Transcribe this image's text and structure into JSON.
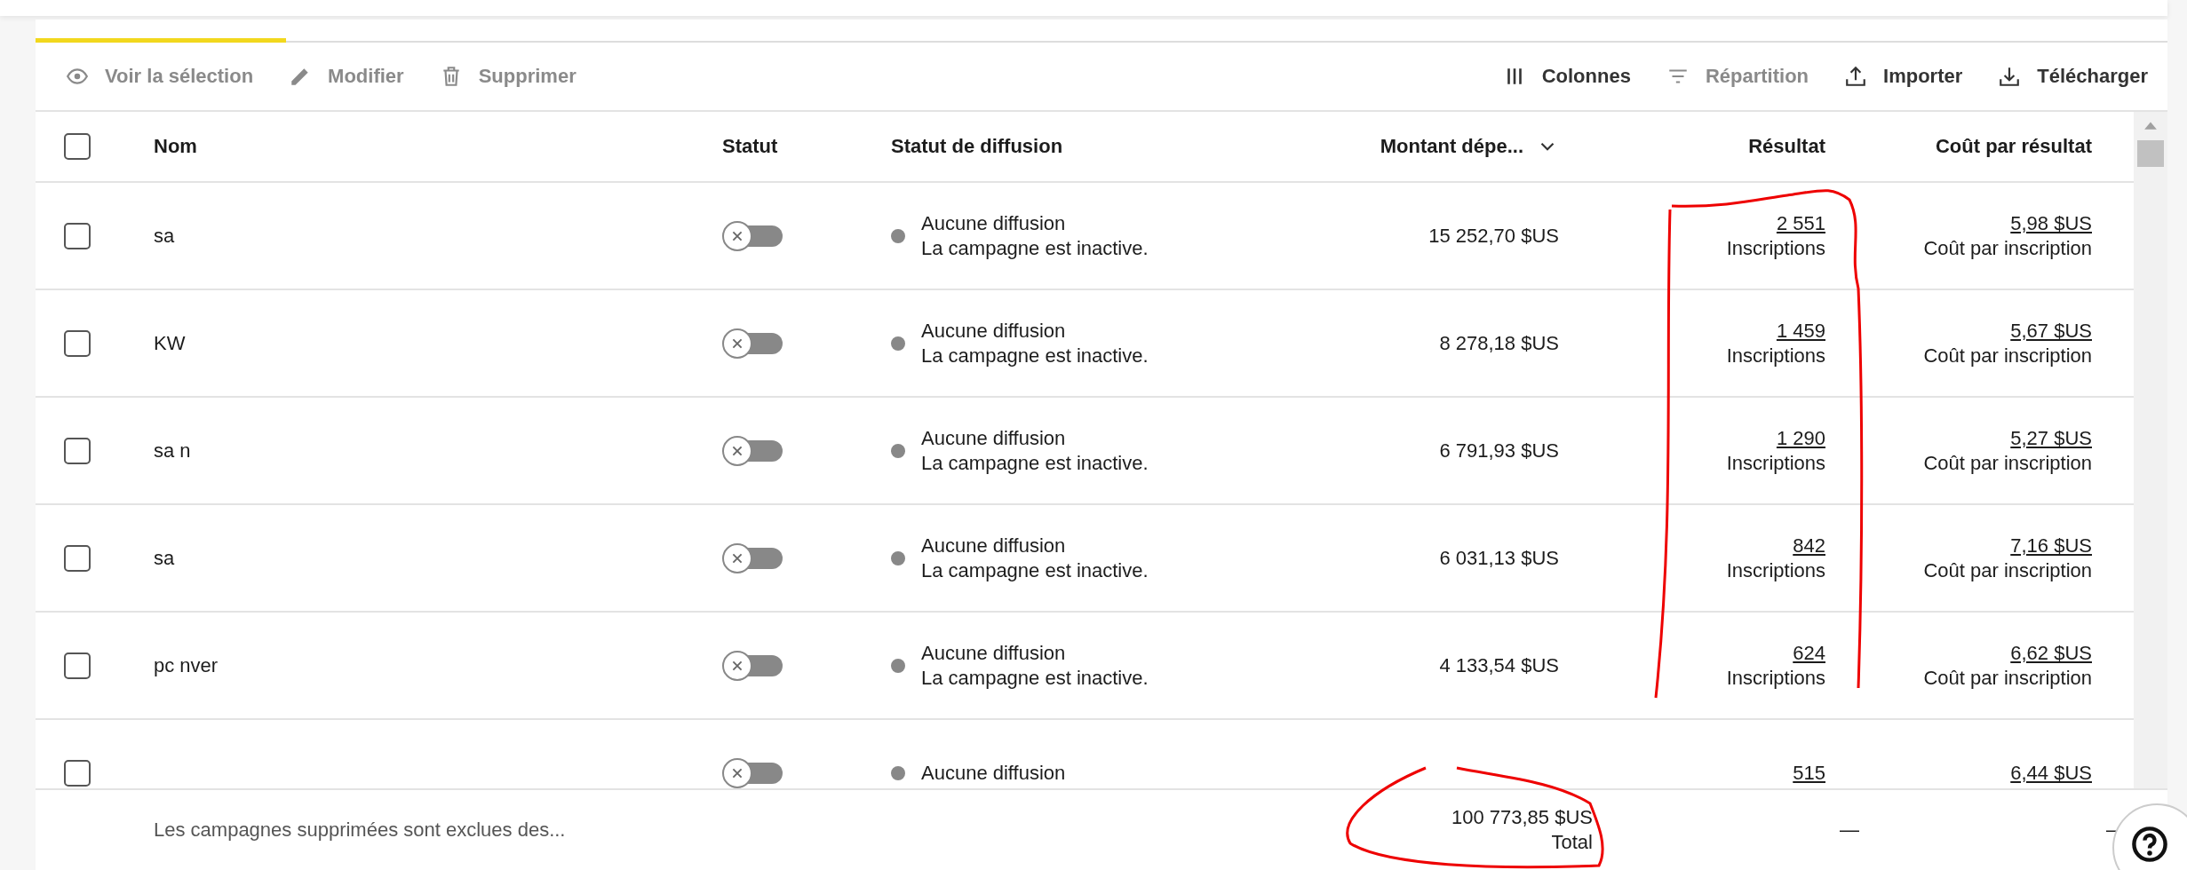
{
  "toolbar": {
    "left": [
      {
        "label": "Voir la sélection",
        "disabled": true
      },
      {
        "label": "Modifier",
        "disabled": true
      },
      {
        "label": "Supprimer",
        "disabled": true
      }
    ],
    "right": [
      {
        "label": "Colonnes",
        "disabled": false
      },
      {
        "label": "Répartition",
        "disabled": true
      },
      {
        "label": "Importer",
        "disabled": false
      },
      {
        "label": "Télécharger",
        "disabled": false
      }
    ]
  },
  "table": {
    "columns": [
      {
        "label": "Nom"
      },
      {
        "label": "Statut"
      },
      {
        "label": "Statut de diffusion"
      },
      {
        "label": "Montant dépe...",
        "sorted": true
      },
      {
        "label": "Résultat"
      },
      {
        "label": "Coût par résultat"
      }
    ],
    "header_checked": false,
    "rows": [
      {
        "checked": false,
        "name": "sa",
        "on": false,
        "delivery": "Aucune diffusion",
        "delivery_note": "La campagne est inactive.",
        "spend": "15 252,70 $US",
        "result": "2 551",
        "result_type": "Inscriptions",
        "cost": "5,98 $US",
        "cost_type": "Coût par inscription"
      },
      {
        "checked": false,
        "name": "KW",
        "on": false,
        "delivery": "Aucune diffusion",
        "delivery_note": "La campagne est inactive.",
        "spend": "8 278,18 $US",
        "result": "1 459",
        "result_type": "Inscriptions",
        "cost": "5,67 $US",
        "cost_type": "Coût par inscription"
      },
      {
        "checked": false,
        "name": "sa n",
        "on": false,
        "delivery": "Aucune diffusion",
        "delivery_note": "La campagne est inactive.",
        "spend": "6 791,93 $US",
        "result": "1 290",
        "result_type": "Inscriptions",
        "cost": "5,27 $US",
        "cost_type": "Coût par inscription"
      },
      {
        "checked": false,
        "name": "sa",
        "on": false,
        "delivery": "Aucune diffusion",
        "delivery_note": "La campagne est inactive.",
        "spend": "6 031,13 $US",
        "result": "842",
        "result_type": "Inscriptions",
        "cost": "7,16 $US",
        "cost_type": "Coût par inscription"
      },
      {
        "checked": false,
        "name": "pc nver",
        "on": false,
        "delivery": "Aucune diffusion",
        "delivery_note": "La campagne est inactive.",
        "spend": "4 133,54 $US",
        "result": "624",
        "result_type": "Inscriptions",
        "cost": "6,62 $US",
        "cost_type": "Coût par inscription"
      },
      {
        "checked": false,
        "on": false,
        "delivery": "Aucune diffusion",
        "result": "515",
        "cost": "6,44 $US"
      }
    ],
    "footer": {
      "note": "Les campagnes supprimées sont exclues des...",
      "total": "100 773,85 $US",
      "total_label": "Total",
      "result": "—",
      "cost": "—"
    }
  }
}
